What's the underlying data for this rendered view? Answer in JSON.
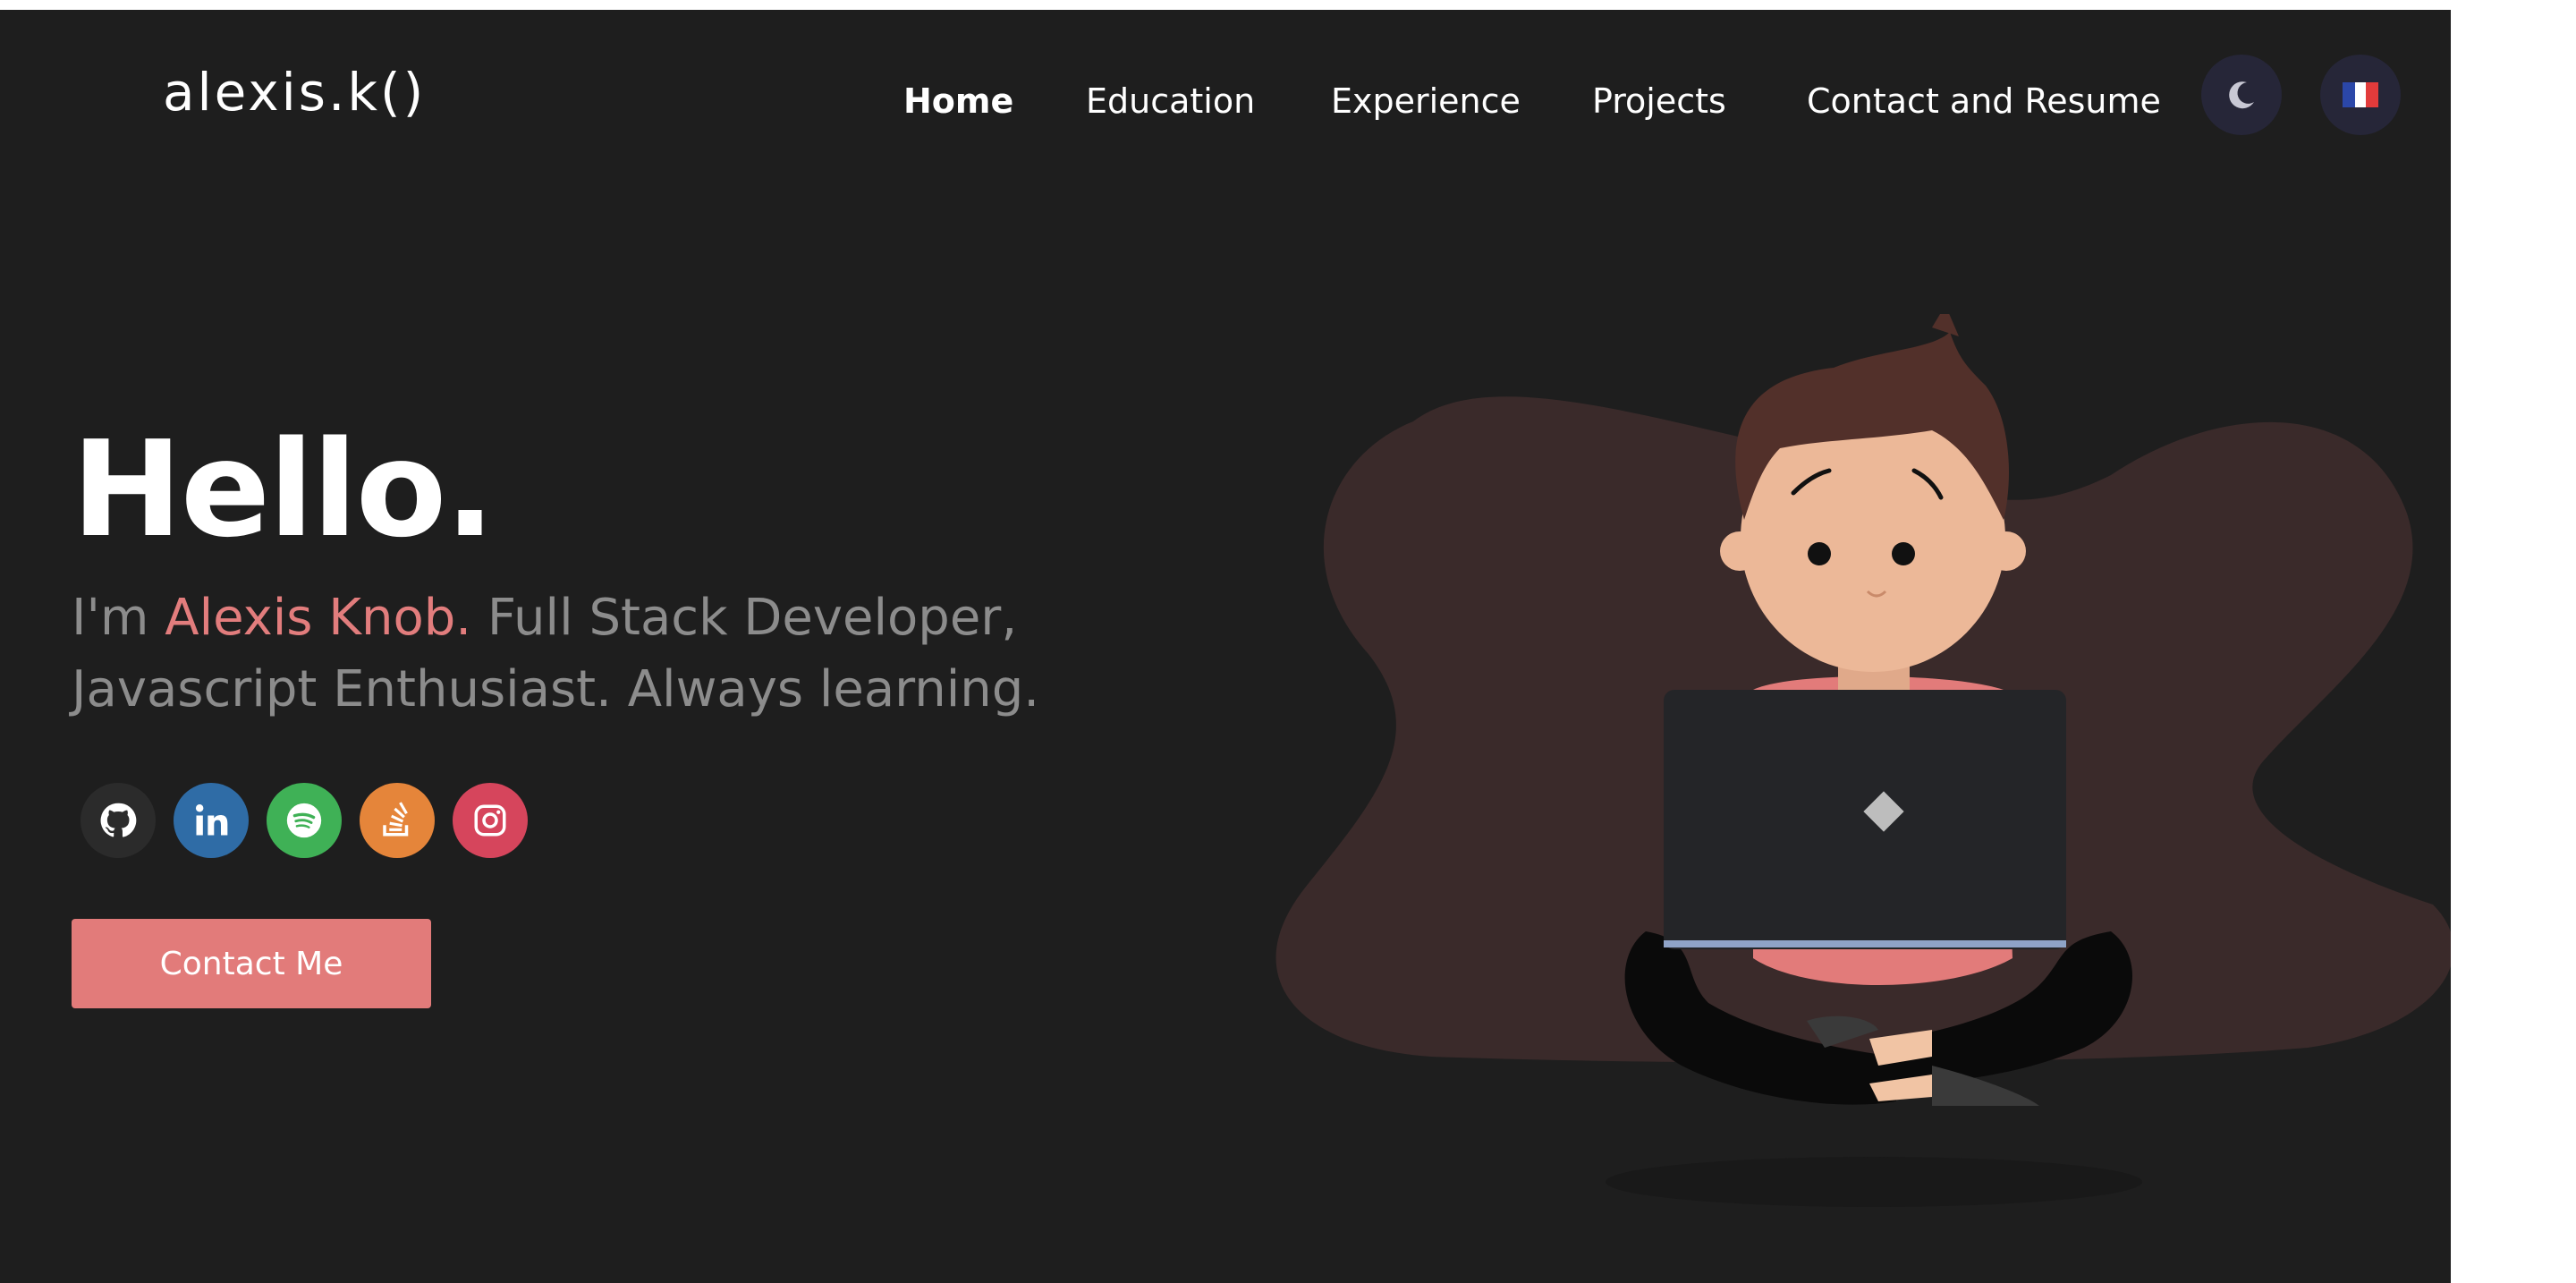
{
  "header": {
    "logo": "alexis.k()",
    "nav": [
      {
        "label": "Home",
        "active": true
      },
      {
        "label": "Education",
        "active": false
      },
      {
        "label": "Experience",
        "active": false
      },
      {
        "label": "Projects",
        "active": false
      },
      {
        "label": "Contact and Resume",
        "active": false
      }
    ],
    "theme_toggle_icon": "moon-icon",
    "language_toggle_icon": "french-flag-icon"
  },
  "hero": {
    "greeting": "Hello.",
    "intro_prefix": "I'm ",
    "intro_name": "Alexis Knob.",
    "intro_rest": " Full Stack Developer, Javascript Enthusiast. Always learning.",
    "cta_label": "Contact Me"
  },
  "socials": [
    {
      "icon": "github-icon",
      "color": "#2b2b2b"
    },
    {
      "icon": "linkedin-icon",
      "color": "#2f6ca6"
    },
    {
      "icon": "spotify-icon",
      "color": "#3fb156"
    },
    {
      "icon": "stackoverflow-icon",
      "color": "#e5853a"
    },
    {
      "icon": "instagram-icon",
      "color": "#d6455c"
    }
  ],
  "colors": {
    "background": "#1e1e1e",
    "accent": "#e27b7a",
    "muted_text": "#8c8c8c",
    "button_circle": "#262638",
    "blob": "#3a2a2a"
  }
}
